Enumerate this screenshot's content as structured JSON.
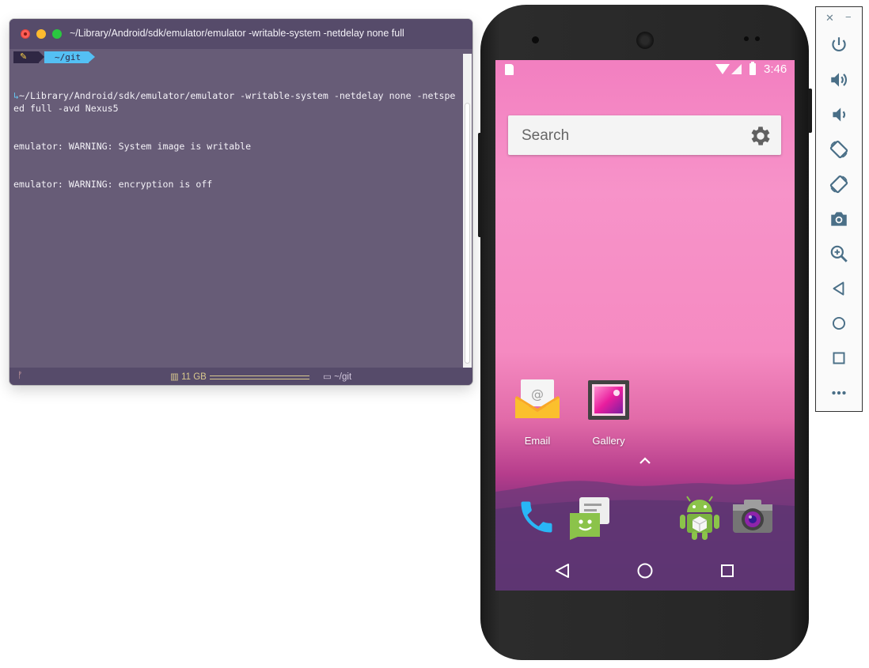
{
  "terminal": {
    "title": "~/Library/Android/sdk/emulator/emulator -writable-system -netdelay none  full",
    "prompt_dir": "~/git",
    "lines": [
      "↳~/Library/Android/sdk/emulator/emulator -writable-system -netdelay none -netspeed full -avd Nexus5",
      "emulator: WARNING: System image is writable",
      "emulator: WARNING: encryption is off"
    ],
    "status": {
      "branch_glyph": "ᚠ",
      "memory": "11 GB",
      "directory": "~/git"
    }
  },
  "phone": {
    "status_bar": {
      "time": "3:46"
    },
    "search": {
      "placeholder": "Search"
    },
    "apps": [
      {
        "label": "Email",
        "icon": "email-icon"
      },
      {
        "label": "Gallery",
        "icon": "gallery-icon"
      }
    ],
    "dock": [
      "phone-icon",
      "messaging-icon",
      "android-icon",
      "camera-icon"
    ],
    "nav": [
      "back-icon",
      "home-icon",
      "recents-icon"
    ]
  },
  "emulator_toolbar": {
    "buttons": [
      "power-icon",
      "volume-up-icon",
      "volume-down-icon",
      "rotate-left-icon",
      "rotate-right-icon",
      "screenshot-icon",
      "zoom-icon",
      "back-icon",
      "home-icon",
      "overview-icon",
      "more-icon"
    ],
    "accent": "#4a6f87"
  }
}
